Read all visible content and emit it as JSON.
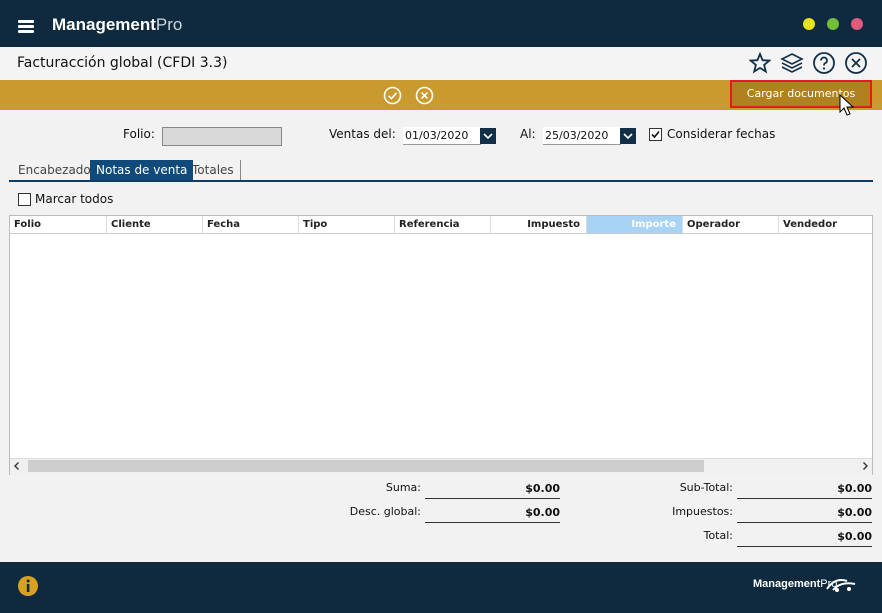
{
  "app": {
    "brand_bold": "Management",
    "brand_light": "Pro"
  },
  "window": {
    "title": "Facturacción global (CFDI 3.3)"
  },
  "toolbar": {
    "load_button": "Cargar documentos"
  },
  "filters": {
    "folio_label": "Folio:",
    "folio_value": "",
    "from_label": "Ventas del:",
    "from_value": "01/03/2020",
    "to_label": "Al:",
    "to_value": "25/03/2020",
    "consider_dates_label": "Considerar fechas",
    "consider_dates_checked": true
  },
  "tabs": [
    {
      "label": "Encabezado",
      "active": false
    },
    {
      "label": "Notas de venta",
      "active": true
    },
    {
      "label": "Totales",
      "active": false
    }
  ],
  "mark_all_label": "Marcar todos",
  "table": {
    "columns": [
      "Folio",
      "Cliente",
      "Fecha",
      "Tipo",
      "Referencia",
      "Impuesto",
      "Importe",
      "Operador",
      "Vendedor"
    ],
    "rows": []
  },
  "summary": {
    "suma_label": "Suma:",
    "suma_value": "$0.00",
    "desc_label": "Desc. global:",
    "desc_value": "$0.00",
    "subtotal_label": "Sub-Total:",
    "subtotal_value": "$0.00",
    "impuestos_label": "Impuestos:",
    "impuestos_value": "$0.00",
    "total_label": "Total:",
    "total_value": "$0.00"
  },
  "footer": {
    "brand_bold": "Management",
    "brand_light": "Pro"
  },
  "colors": {
    "navy": "#0f2a3f",
    "gold": "#c99a2e",
    "tab_active": "#0f4a7a",
    "highlight": "#e8191c"
  }
}
